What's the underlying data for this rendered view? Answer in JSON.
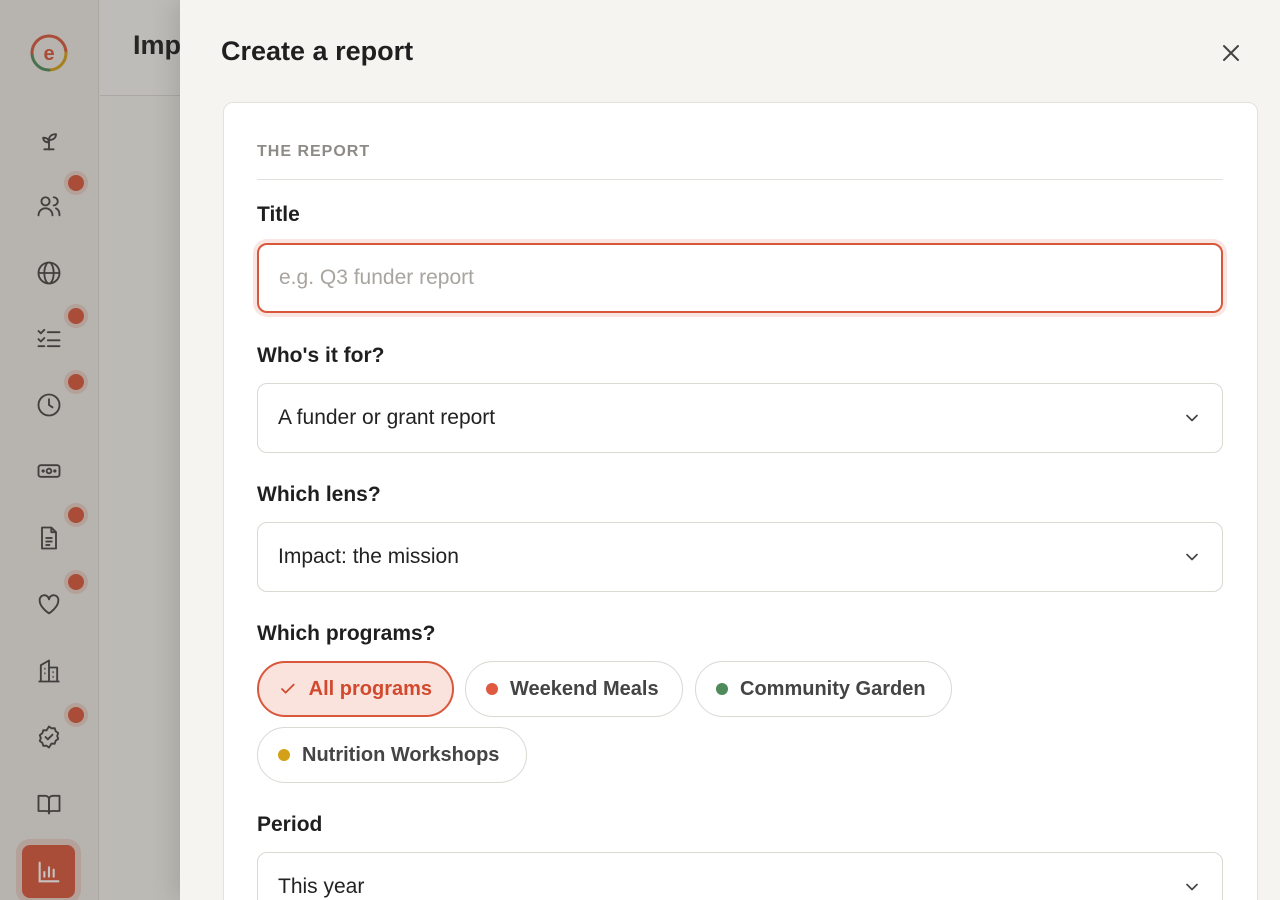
{
  "app": {
    "page_title": "Imp",
    "brand_color": "#d9573b"
  },
  "sidebar": {
    "logo_letter": "e",
    "items": [
      {
        "icon": "sprout-icon",
        "badge": false
      },
      {
        "icon": "users-icon",
        "badge": true
      },
      {
        "icon": "globe-icon",
        "badge": false
      },
      {
        "icon": "checklist-icon",
        "badge": true
      },
      {
        "icon": "clock-icon",
        "badge": true
      },
      {
        "icon": "cash-icon",
        "badge": false
      },
      {
        "icon": "document-icon",
        "badge": true
      },
      {
        "icon": "heart-icon",
        "badge": true
      },
      {
        "icon": "building-icon",
        "badge": false
      },
      {
        "icon": "verified-badge-icon",
        "badge": true
      },
      {
        "icon": "book-icon",
        "badge": false
      },
      {
        "icon": "bar-chart-icon",
        "badge": false,
        "active": true
      }
    ]
  },
  "drawer": {
    "title": "Create a report",
    "section_label": "THE REPORT",
    "title_field": {
      "label": "Title",
      "value": "",
      "placeholder": "e.g. Q3 funder report"
    },
    "audience_field": {
      "label": "Who's it for?",
      "value": "A funder or grant report"
    },
    "lens_field": {
      "label": "Which lens?",
      "value": "Impact: the mission"
    },
    "programs_field": {
      "label": "Which programs?",
      "chips": [
        {
          "label": "All programs",
          "selected": true
        },
        {
          "label": "Weekend Meals",
          "color": "#e05a42"
        },
        {
          "label": "Community Garden",
          "color": "#4f8a5a"
        },
        {
          "label": "Nutrition Workshops",
          "color": "#d4a017"
        }
      ]
    },
    "period_field": {
      "label": "Period",
      "value": "This year"
    }
  }
}
